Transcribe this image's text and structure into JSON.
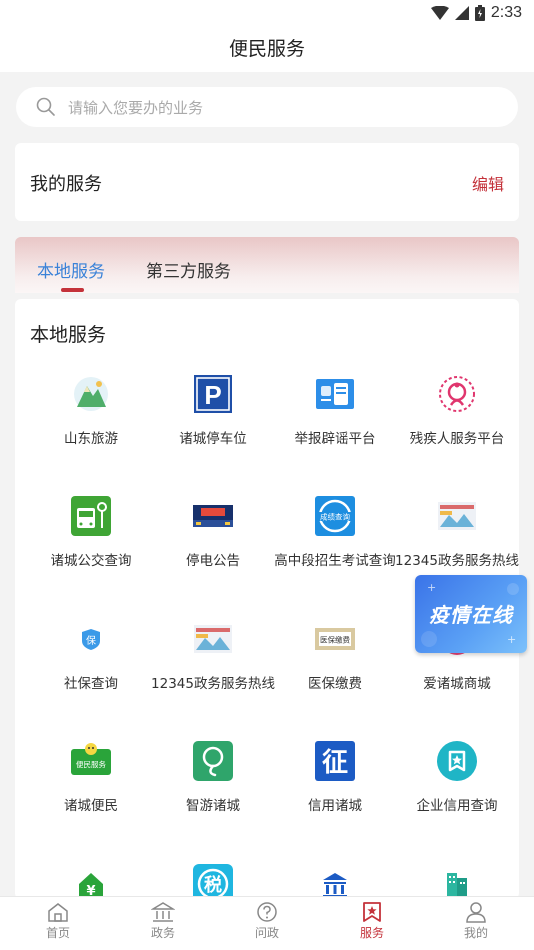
{
  "status": {
    "time": "2:33"
  },
  "header": {
    "title": "便民服务"
  },
  "search": {
    "placeholder": "请输入您要办的业务"
  },
  "my_services": {
    "title": "我的服务",
    "edit_label": "编辑"
  },
  "tabs": [
    {
      "label": "本地服务",
      "active": true
    },
    {
      "label": "第三方服务",
      "active": false
    }
  ],
  "local": {
    "section_title": "本地服务",
    "items": [
      {
        "label": "山东旅游",
        "icon": "mountain-icon"
      },
      {
        "label": "诸城停车位",
        "icon": "parking-icon"
      },
      {
        "label": "举报辟谣平台",
        "icon": "report-icon"
      },
      {
        "label": "残疾人服务平台",
        "icon": "disability-icon"
      },
      {
        "label": "诸城公交查询",
        "icon": "bus-icon"
      },
      {
        "label": "停电公告",
        "icon": "power-notice-icon"
      },
      {
        "label": "高中段招生考试查询",
        "icon": "exam-query-icon"
      },
      {
        "label": "12345政务服务热线",
        "icon": "hotline-icon"
      },
      {
        "label": "社保查询",
        "icon": "social-security-icon"
      },
      {
        "label": "12345政务服务热线",
        "icon": "hotline-icon"
      },
      {
        "label": "医保缴费",
        "icon": "medical-insurance-icon"
      },
      {
        "label": "爱诸城商城",
        "icon": "mall-icon"
      },
      {
        "label": "诸城便民",
        "icon": "convenience-icon"
      },
      {
        "label": "智游诸城",
        "icon": "smart-tour-icon"
      },
      {
        "label": "信用诸城",
        "icon": "credit-icon"
      },
      {
        "label": "企业信用查询",
        "icon": "enterprise-credit-icon"
      },
      {
        "label": "",
        "icon": "housing-fund-icon"
      },
      {
        "label": "",
        "icon": "tax-icon"
      },
      {
        "label": "",
        "icon": "bank-icon"
      },
      {
        "label": "",
        "icon": "building-icon"
      }
    ]
  },
  "icon_text": {
    "parking": "P",
    "bianmin": "便民服务",
    "credit": "征",
    "tax": "税",
    "yibao": "医保缴费",
    "shebao": "保",
    "exam": "成绩查询",
    "housing": "¥"
  },
  "float_banner": {
    "text": "疫情在线"
  },
  "bottom_nav": [
    {
      "label": "首页",
      "icon": "home-icon",
      "active": false
    },
    {
      "label": "政务",
      "icon": "government-icon",
      "active": false
    },
    {
      "label": "问政",
      "icon": "question-icon",
      "active": false
    },
    {
      "label": "服务",
      "icon": "service-icon",
      "active": true
    },
    {
      "label": "我的",
      "icon": "user-icon",
      "active": false
    }
  ],
  "colors": {
    "accent": "#c4323a",
    "tab_active": "#3a82d8"
  }
}
